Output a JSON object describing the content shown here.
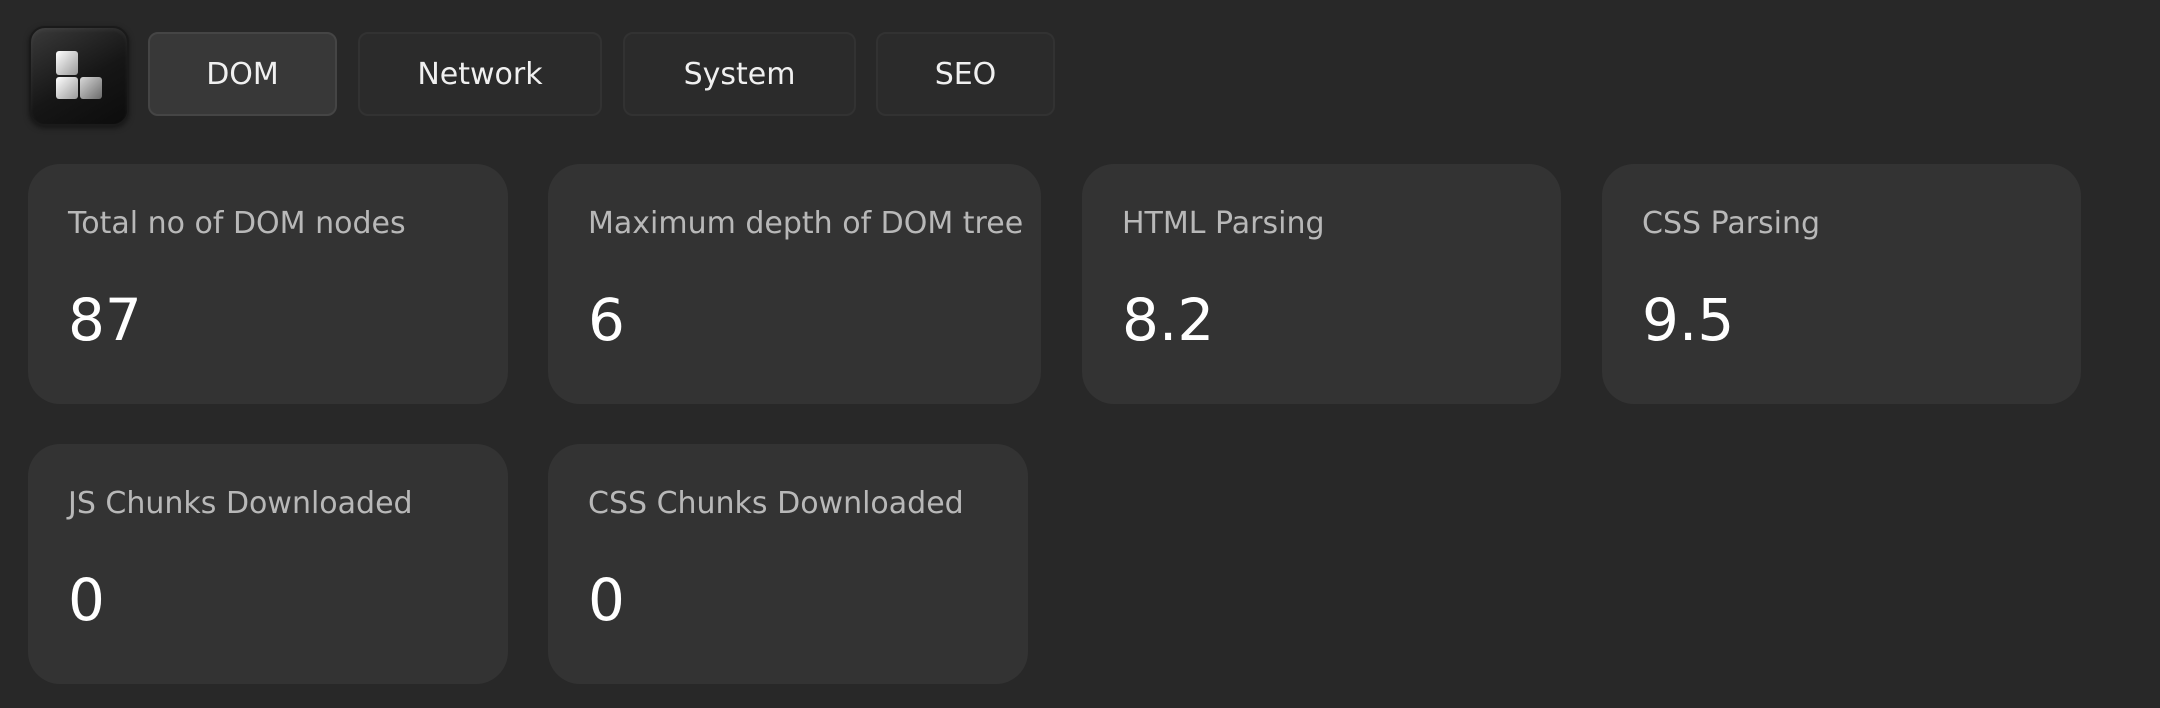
{
  "app": {
    "logo_icon": "blocks-logo-icon"
  },
  "tabs": [
    {
      "label": "DOM",
      "active": true
    },
    {
      "label": "Network",
      "active": false
    },
    {
      "label": "System",
      "active": false
    },
    {
      "label": "SEO",
      "active": false
    }
  ],
  "metrics": [
    {
      "label": "Total no of DOM nodes",
      "value": "87"
    },
    {
      "label": "Maximum depth of DOM tree",
      "value": "6"
    },
    {
      "label": "HTML Parsing",
      "value": "8.2"
    },
    {
      "label": "CSS Parsing",
      "value": "9.5"
    },
    {
      "label": "JS Chunks Downloaded",
      "value": "0"
    },
    {
      "label": "CSS Chunks Downloaded",
      "value": "0"
    }
  ],
  "colors": {
    "background": "#282828",
    "card": "#333333",
    "label": "#b8b8b8",
    "value": "#ffffff"
  }
}
